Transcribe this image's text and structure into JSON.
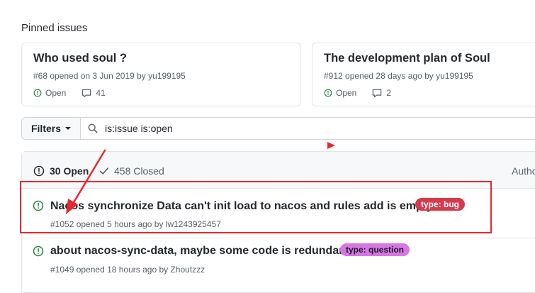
{
  "pinned": {
    "heading": "Pinned issues",
    "cards": [
      {
        "title": "Who used soul ?",
        "meta": "#68 opened on 3 Jun 2019 by yu199195",
        "status": "Open",
        "comments": "41"
      },
      {
        "title": "The development plan of Soul",
        "meta": "#912 opened 28 days ago by yu199195",
        "status": "Open",
        "comments": "2"
      }
    ]
  },
  "filters": {
    "button_label": "Filters",
    "search_value": "is:issue is:open"
  },
  "list": {
    "open_label": "30 Open",
    "closed_label": "458 Closed",
    "author_label": "Autho",
    "issues": [
      {
        "title": "Nacos synchronize Data can't init load to nacos and rules add is empty",
        "label": "type: bug",
        "meta": "#1052 opened 5 hours ago by lw1243925457"
      },
      {
        "title": "about nacos-sync-data, maybe some code is redundant.",
        "label": "type: question",
        "meta": "#1049 opened 18 hours ago by Zhoutzzz"
      }
    ]
  },
  "colors": {
    "open_green": "#22863a",
    "annotation_red": "#e8262e",
    "bug_label": "#d73a4a",
    "question_label": "#d876e3"
  },
  "icons": [
    "issue-opened-icon",
    "comment-icon",
    "search-icon",
    "check-icon",
    "caret-down-icon"
  ]
}
